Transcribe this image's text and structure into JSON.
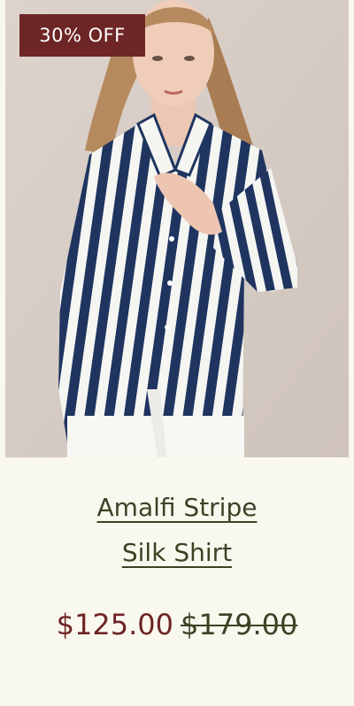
{
  "badge": {
    "label": "30% OFF"
  },
  "product": {
    "title_line1": "Amalfi Stripe",
    "title_line2": "Silk Shirt",
    "sale_price": "$125.00",
    "original_price": "$179.00"
  },
  "colors": {
    "page_background": "#f9f8ef",
    "badge_background": "#6e2525",
    "title_text": "#3a4323",
    "sale_price_text": "#6e2525",
    "shirt_stripe_navy": "#1f3560",
    "shirt_white": "#f5f5f2"
  }
}
